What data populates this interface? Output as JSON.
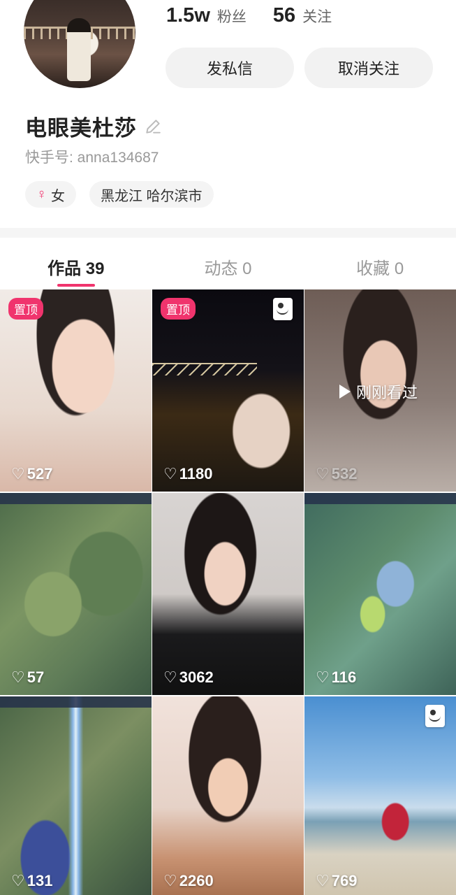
{
  "profile": {
    "followers_count": "1.5w",
    "followers_label": "粉丝",
    "following_count": "56",
    "following_label": "关注",
    "message_button": "发私信",
    "unfollow_button": "取消关注",
    "name": "电眼美杜莎",
    "account_id": "快手号: anna134687",
    "gender_symbol": "♀",
    "gender": "女",
    "location": "黑龙江 哈尔滨市"
  },
  "tabs": [
    {
      "label": "作品 39",
      "active": true
    },
    {
      "label": "动态 0",
      "active": false
    },
    {
      "label": "收藏 0",
      "active": false
    }
  ],
  "colors": {
    "accent": "#f0346d"
  },
  "works": [
    {
      "likes": "527",
      "pinned_label": "置顶"
    },
    {
      "likes": "1180",
      "pinned_label": "置顶",
      "icon": "photo-icon"
    },
    {
      "likes": "532",
      "watched_label": "刚刚看过"
    },
    {
      "likes": "57"
    },
    {
      "likes": "3062"
    },
    {
      "likes": "116"
    },
    {
      "likes": "131"
    },
    {
      "likes": "2260"
    },
    {
      "likes": "769",
      "icon": "photo-icon"
    }
  ],
  "icons": {
    "heart": "♡",
    "edit": "pencil-icon"
  }
}
